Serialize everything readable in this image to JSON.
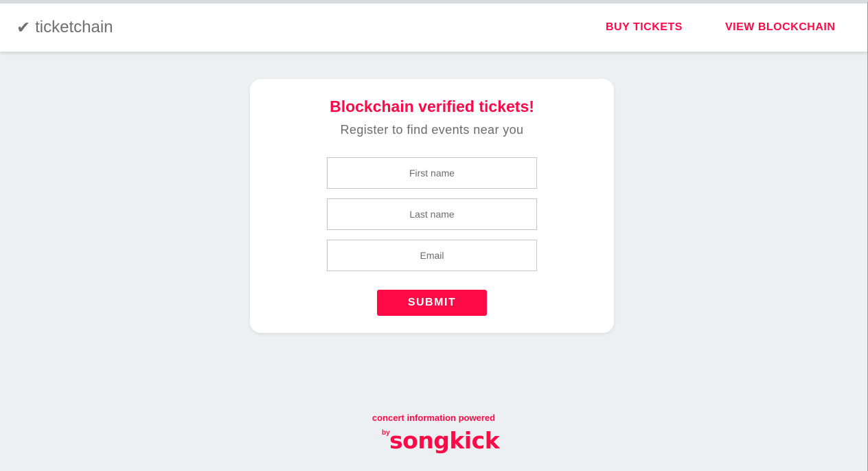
{
  "header": {
    "brand_icon": "checkmark-icon",
    "brand_name": "ticketchain",
    "nav": {
      "buy_tickets": "BUY TICKETS",
      "view_blockchain": "VIEW BLOCKCHAIN"
    }
  },
  "form": {
    "title": "Blockchain verified tickets!",
    "subtitle": "Register to find events near you",
    "first_name": {
      "placeholder": "First name",
      "value": ""
    },
    "last_name": {
      "placeholder": "Last name",
      "value": ""
    },
    "email": {
      "placeholder": "Email",
      "value": ""
    },
    "submit_label": "SUBMIT"
  },
  "footer": {
    "powered_text": "concert information powered",
    "logo_by": "by",
    "logo_word": "songkick"
  },
  "colors": {
    "accent": "#ff0a47",
    "background": "#edf0f2",
    "card": "#ffffff",
    "muted_text": "#6f6f6f"
  }
}
